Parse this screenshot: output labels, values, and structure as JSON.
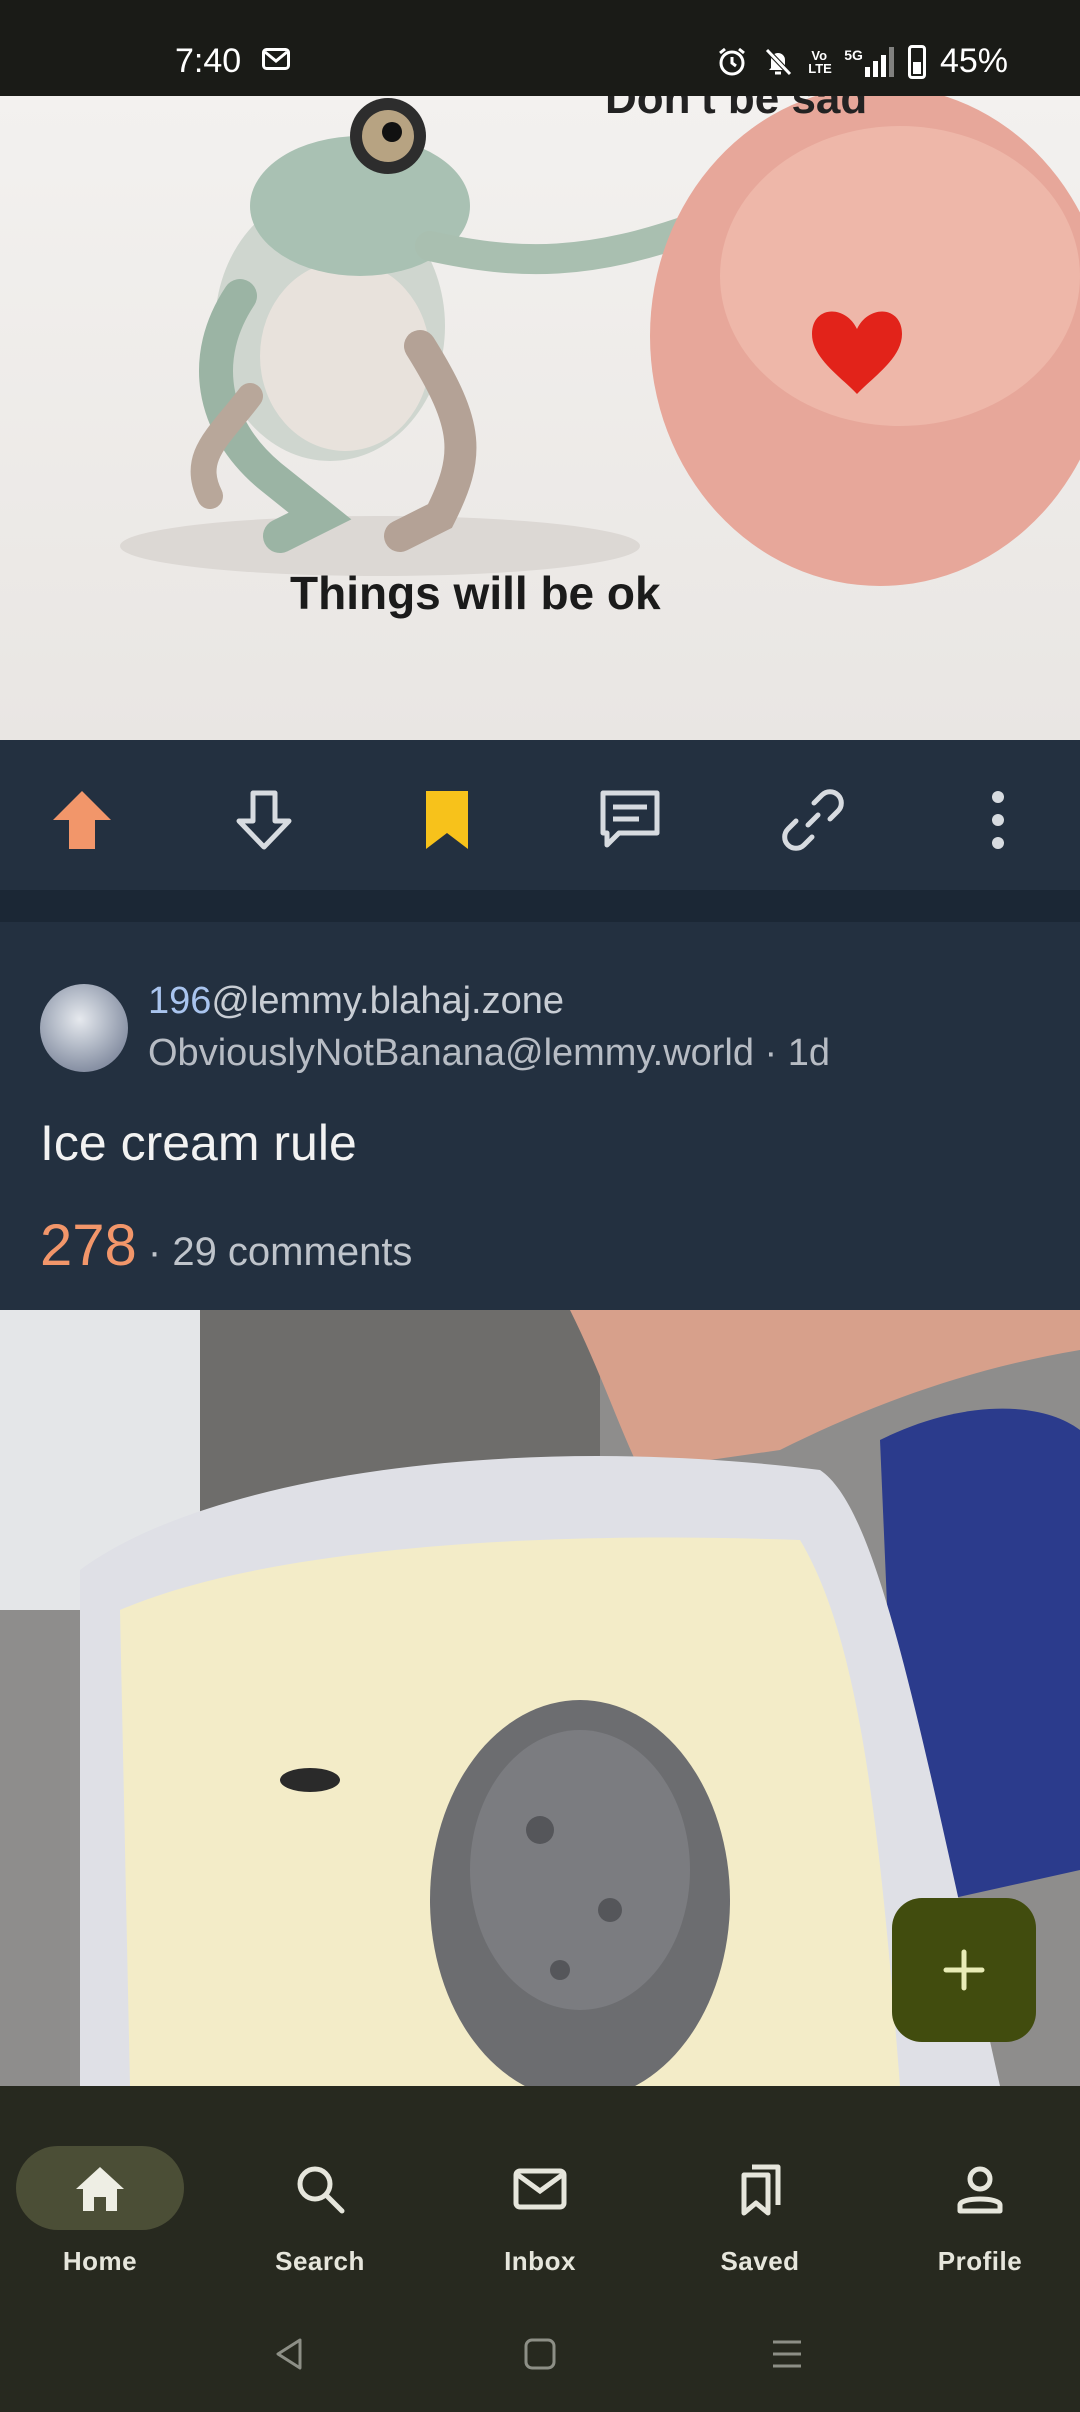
{
  "status_bar": {
    "time": "7:40",
    "volte": "Vo LTE",
    "network": "5G",
    "battery": "45%",
    "battery_level": 0.45,
    "icons": [
      "mail-icon",
      "alarm-icon",
      "mute-icon",
      "volte-icon",
      "signal-icon",
      "battery-icon"
    ]
  },
  "previous_post": {
    "image_caption_top": "Don't be sad",
    "image_caption": "Things will be ok",
    "actions": [
      {
        "name": "upvote-icon",
        "active": true,
        "color": "#f2966a"
      },
      {
        "name": "downvote-icon",
        "active": false
      },
      {
        "name": "bookmark-icon",
        "active": true,
        "color": "#f7c21b"
      },
      {
        "name": "comment-icon",
        "active": false
      },
      {
        "name": "link-icon",
        "active": false
      },
      {
        "name": "more-vert-icon",
        "active": false
      }
    ]
  },
  "post": {
    "community_number": "196",
    "community_instance": "@lemmy.blahaj.zone",
    "author": "ObviouslyNotBanana@lemmy.world",
    "age": " · 1d",
    "title": "Ice cream rule",
    "score": "278",
    "comments": " · 29 comments"
  },
  "fab": {
    "icon": "plus-icon"
  },
  "bottom_nav": {
    "items": [
      {
        "label": "Home",
        "icon": "home-icon",
        "active": true
      },
      {
        "label": "Search",
        "icon": "search-icon",
        "active": false
      },
      {
        "label": "Inbox",
        "icon": "inbox-icon",
        "active": false
      },
      {
        "label": "Saved",
        "icon": "saved-icon",
        "active": false
      },
      {
        "label": "Profile",
        "icon": "profile-icon",
        "active": false
      }
    ]
  },
  "system_nav": {
    "icons": [
      "back-icon",
      "home-square-icon",
      "recents-icon"
    ]
  },
  "colors": {
    "background": "#233040",
    "accent_orange": "#f2966a",
    "bookmark_yellow": "#f7c21b",
    "fab": "#414c0e",
    "nav_bar": "#27291f"
  }
}
